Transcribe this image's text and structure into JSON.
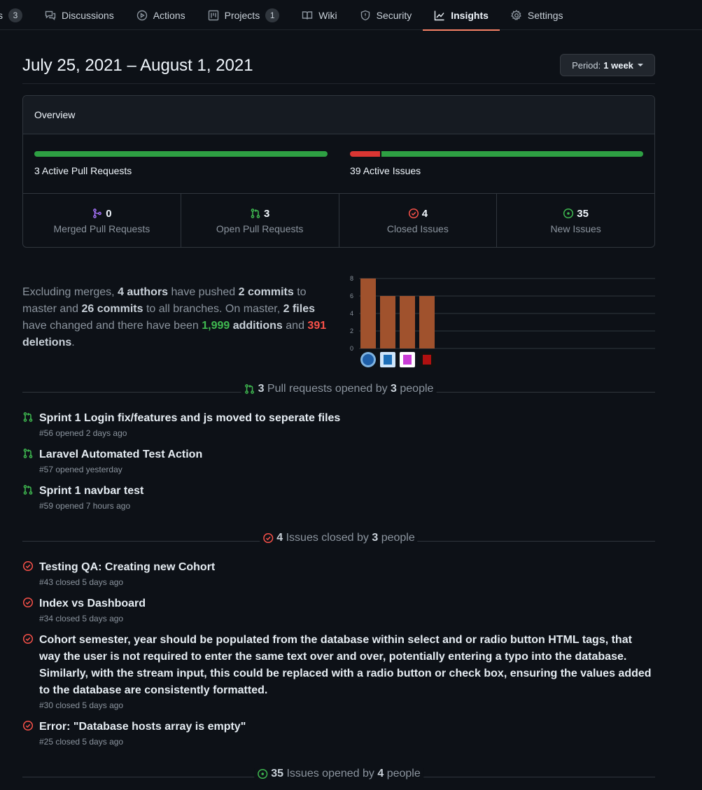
{
  "nav": {
    "tabs": [
      {
        "label": "s",
        "count": "3",
        "icon": "issue-icon"
      },
      {
        "label": "Discussions",
        "icon": "discussion-icon"
      },
      {
        "label": "Actions",
        "icon": "play-icon"
      },
      {
        "label": "Projects",
        "count": "1",
        "icon": "project-icon"
      },
      {
        "label": "Wiki",
        "icon": "book-icon"
      },
      {
        "label": "Security",
        "icon": "shield-icon"
      },
      {
        "label": "Insights",
        "icon": "graph-icon",
        "active": true
      },
      {
        "label": "Settings",
        "icon": "gear-icon"
      }
    ]
  },
  "header": {
    "date_range": "July 25, 2021 – August 1, 2021",
    "period_prefix": "Period:",
    "period_value": "1 week"
  },
  "overview": {
    "title": "Overview",
    "pr_bar_label": "3 Active Pull Requests",
    "pr_active_fraction": 1.0,
    "issues_bar_label": "39 Active Issues",
    "issues_closed_fraction": 0.103,
    "stats": [
      {
        "value": "0",
        "label": "Merged Pull Requests",
        "icon": "git-merge-icon",
        "color": "#a371f7"
      },
      {
        "value": "3",
        "label": "Open Pull Requests",
        "icon": "git-pull-request-icon",
        "color": "#3fb950"
      },
      {
        "value": "4",
        "label": "Closed Issues",
        "icon": "issue-closed-icon",
        "color": "#f85149"
      },
      {
        "value": "35",
        "label": "New Issues",
        "icon": "issue-opened-icon",
        "color": "#3fb950"
      }
    ]
  },
  "summary": {
    "t1": "Excluding merges, ",
    "authors": "4 authors",
    "t2": " have pushed ",
    "commits_master": "2 commits",
    "t3": " to master and ",
    "commits_all": "26 commits",
    "t4": " to all branches. On master, ",
    "files": "2 files",
    "t5": " have changed and there have been ",
    "additions_num": "1,999",
    "additions_word": " additions",
    "t6": " and ",
    "deletions_num": "391",
    "deletions_word": " deletions",
    "t7": "."
  },
  "chart_data": {
    "type": "bar",
    "categories": [
      "author-1",
      "author-2",
      "author-3",
      "author-4"
    ],
    "values": [
      8,
      6,
      6,
      6
    ],
    "ylim": [
      0,
      8
    ],
    "yticks": [
      "0",
      "2",
      "4",
      "6",
      "8"
    ],
    "bar_color": "#a0522d",
    "grid": true
  },
  "pull_requests": {
    "count": "3",
    "mid": " Pull requests opened by ",
    "people": "3",
    "tail": " people",
    "items": [
      {
        "title": "Sprint 1 Login fix/features and js moved to seperate files",
        "meta": "#56 opened 2 days ago"
      },
      {
        "title": "Laravel Automated Test Action",
        "meta": "#57 opened yesterday"
      },
      {
        "title": "Sprint 1 navbar test",
        "meta": "#59 opened 7 hours ago"
      }
    ]
  },
  "closed_issues": {
    "count": "4",
    "mid": " Issues closed by ",
    "people": "3",
    "tail": " people",
    "items": [
      {
        "title": "Testing QA: Creating new Cohort",
        "meta": "#43 closed 5 days ago"
      },
      {
        "title": "Index vs Dashboard",
        "meta": "#34 closed 5 days ago"
      },
      {
        "title": "Cohort semester, year should be populated from the database within select and or radio button HTML tags, that way the user is not required to enter the same text over and over, potentially entering a typo into the database. Similarly, with the stream input, this could be replaced with a radio button or check box, ensuring the values added to the database are consistently formatted.",
        "meta": "#30 closed 5 days ago"
      },
      {
        "title": "Error: \"Database hosts array is empty\"",
        "meta": "#25 closed 5 days ago"
      }
    ]
  },
  "opened_issues": {
    "count": "35",
    "mid": " Issues opened by ",
    "people": "4",
    "tail": " people"
  }
}
